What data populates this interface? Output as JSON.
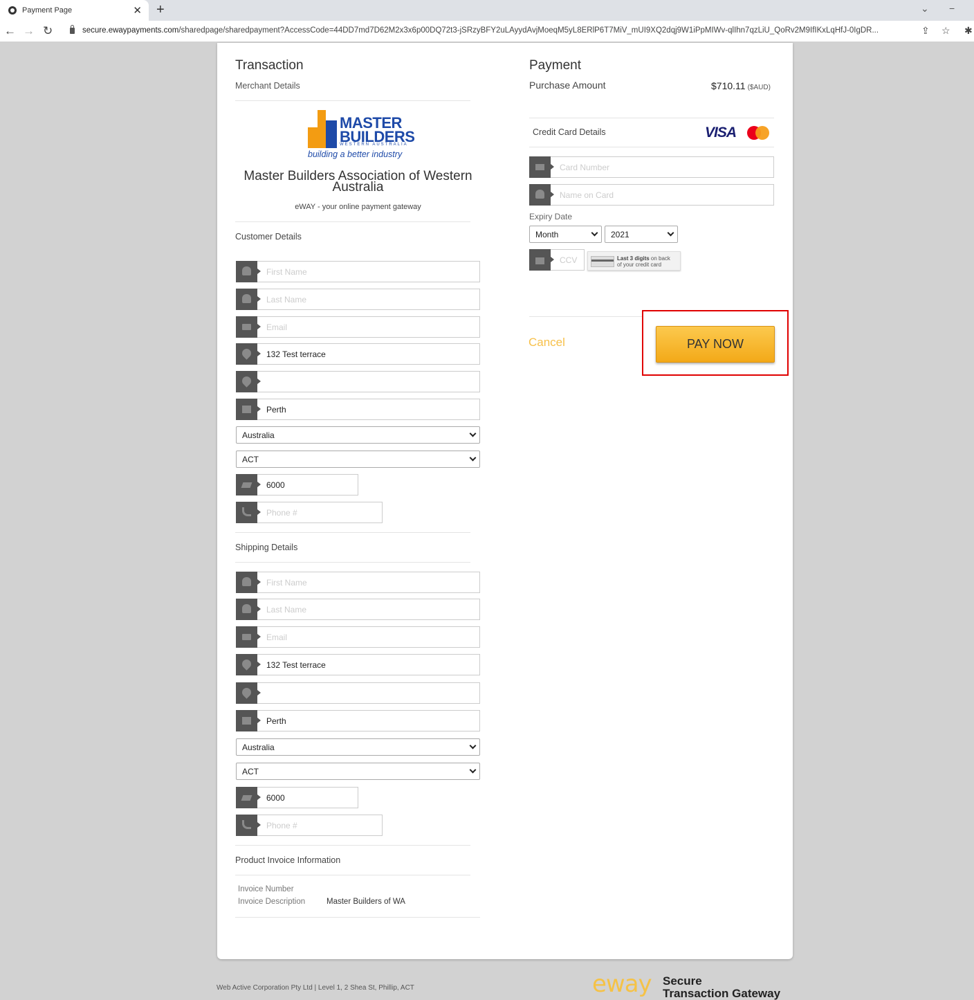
{
  "browser": {
    "tab_title": "Payment Page",
    "url_domain": "secure.ewaypayments.com",
    "url_path": "/sharedpage/sharedpayment?AccessCode=44DD7md7D62M2x3x6p00DQ72t3-jSRzyBFY2uLAyydAvjMoeqM5yL8ERlP6T7MiV_mUI9XQ2dqj9W1iPpMIWv-qlIhn7qzLiU_QoRv2M9IfIKxLqHfJ-0IgDR..."
  },
  "transaction": {
    "title": "Transaction",
    "merchant_details_label": "Merchant Details",
    "logo": {
      "line1": "MASTER",
      "line2": "BUILDERS",
      "line3": "WESTERN AUSTRALIA",
      "tagline": "building a better industry"
    },
    "merchant_name": "Master Builders Association of Western Australia",
    "gateway_text": "eWAY - your online payment gateway"
  },
  "customer": {
    "label": "Customer Details",
    "first_name_placeholder": "First Name",
    "last_name_placeholder": "Last Name",
    "email_placeholder": "Email",
    "address1": "132 Test terrace",
    "address2": "",
    "city": "Perth",
    "country": "Australia",
    "state": "ACT",
    "postcode": "6000",
    "phone_placeholder": "Phone #"
  },
  "shipping": {
    "label": "Shipping Details",
    "first_name_placeholder": "First Name",
    "last_name_placeholder": "Last Name",
    "email_placeholder": "Email",
    "address1": "132 Test terrace",
    "address2": "",
    "city": "Perth",
    "country": "Australia",
    "state": "ACT",
    "postcode": "6000",
    "phone_placeholder": "Phone #"
  },
  "invoice": {
    "label": "Product Invoice Information",
    "number_label": "Invoice Number",
    "description_label": "Invoice Description",
    "description_value": "Master Builders of WA"
  },
  "payment": {
    "title": "Payment",
    "purchase_amount_label": "Purchase Amount",
    "amount": "$710.11",
    "currency": "($AUD)",
    "credit_card_label": "Credit Card Details",
    "visa_text": "VISA",
    "card_number_placeholder": "Card Number",
    "name_on_card_placeholder": "Name on Card",
    "expiry_label": "Expiry Date",
    "expiry_month": "Month",
    "expiry_year": "2021",
    "ccv_placeholder": "CCV",
    "ccv_hint_bold": "Last 3 digits",
    "ccv_hint_rest1": " on back",
    "ccv_hint_line2": "of your credit card",
    "cancel_label": "Cancel",
    "pay_now_label": "PAY NOW"
  },
  "footer": {
    "company_text": "Web Active Corporation Pty Ltd | Level 1, 2 Shea St, Phillip, ACT",
    "eway_logo": "eway",
    "eway_tagline1": "Secure",
    "eway_tagline2": "Transaction Gateway"
  },
  "colors": {
    "accent": "#f3a918",
    "highlight_border": "#e00000",
    "brand_blue": "#1e4aa8"
  }
}
